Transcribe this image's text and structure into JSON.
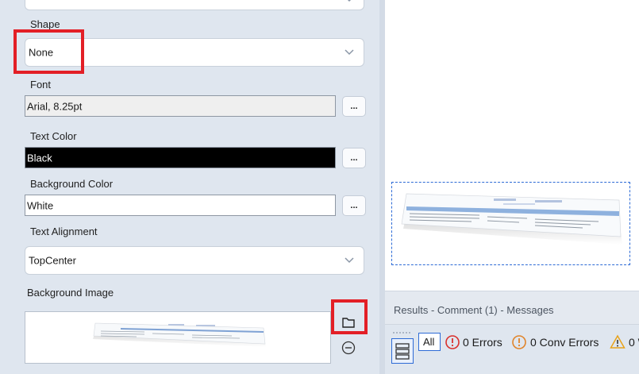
{
  "properties": {
    "shape": {
      "label": "Shape",
      "value": "None"
    },
    "font": {
      "label": "Font",
      "value": "Arial, 8.25pt",
      "button": "..."
    },
    "text_color": {
      "label": "Text Color",
      "value": "Black",
      "swatch": "#000000",
      "button": "..."
    },
    "background_color": {
      "label": "Background Color",
      "value": "White",
      "swatch": "#ffffff",
      "button": "..."
    },
    "text_alignment": {
      "label": "Text Alignment",
      "value": "TopCenter"
    },
    "background_image": {
      "label": "Background Image"
    }
  },
  "results": {
    "title": "Results - Comment (1) - Messages",
    "filters": {
      "all": "All",
      "errors": "0 Errors",
      "conv_errors": "0 Conv Errors",
      "warnings": "0 W"
    }
  },
  "colors": {
    "highlight": "#e31f26",
    "accent": "#2d6bd6",
    "error": "#d9302c",
    "warning": "#e8a21a"
  },
  "icons": [
    "chevron-down-icon",
    "folder-icon",
    "remove-circle-icon",
    "list-layout-icon",
    "error-circle-icon",
    "warning-triangle-icon"
  ]
}
